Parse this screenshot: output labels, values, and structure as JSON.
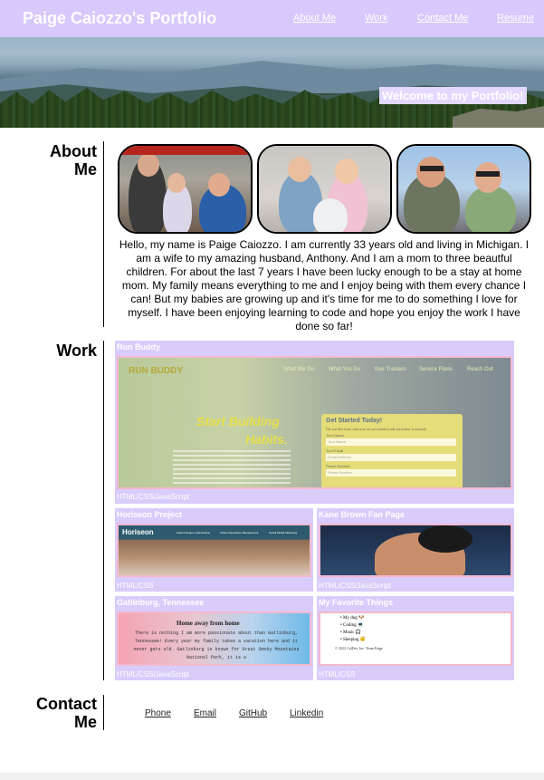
{
  "header": {
    "title": "Paige Caiozzo's Portfolio",
    "nav": [
      "About Me",
      "Work",
      "Contact Me",
      "Resume"
    ]
  },
  "hero": {
    "welcome": "Welcome to my Portfolio!"
  },
  "about": {
    "heading_line1": "About",
    "heading_line2": "Me",
    "text": "Hello, my name is Paige Caiozzo. I am currently 33 years old and living in Michigan. I am a wife to my amazing husband, Anthony. And I am a mom to three beautful children. For about the last 7 years I have been lucky enough to be a stay at home mom. My family means everything to me and I enjoy being with them every chance I can! But my babies are growing up and it's time for me to do something I love for myself. I have been enjoying learning to code and hope you enjoy the work I have done so far!"
  },
  "work": {
    "heading": "Work",
    "projects": [
      {
        "title": "Run Buddy",
        "tech": "HTML/CSS/JavaScript",
        "screenshot": {
          "logo": "RUN BUDDY",
          "nav": [
            "What We Do",
            "What You Do",
            "Your Trainers",
            "Service Plans",
            "Reach Out"
          ],
          "headline_1": "Start Building",
          "headline_2": "Habits.",
          "form_title": "Get Started Today!",
          "form_sub": "Fill out this form and one of our trainers will schedule a consult.",
          "field_1_label": "Your Name",
          "field_1_placeholder": "Your Name",
          "field_2_label": "Your Email",
          "field_2_placeholder": "Email Address",
          "field_3_label": "Phone Number",
          "field_3_placeholder": "Phone Number"
        }
      },
      {
        "title": "Horiseon Project",
        "tech": "HTML/CSS",
        "screenshot": {
          "logo": "Horiseon",
          "nav": [
            "Search Engine Optimization",
            "Online Reputation Management",
            "Social Media Marketing"
          ]
        }
      },
      {
        "title": "Kane Brown Fan Page",
        "tech": "HTML/CSS/JavaScript",
        "screenshot": {}
      },
      {
        "title": "Gatlinburg, Tennessee",
        "tech": "HTML/CSS/JavaScript",
        "screenshot": {
          "heading": "Home away from home",
          "body": "There is nothing I am more passionate about than Gatlinburg, Tennessee! Every year my family takes a vacation here and it never gets old. Gatlinburg is known for Great Smoky Mountains National Park, it is a"
        }
      },
      {
        "title": "My Favorite Things",
        "tech": "HTML/CSS",
        "screenshot": {
          "items": [
            "My dog 🐶",
            "Coding 💻",
            "Music 🎧",
            "Sleeping 😴"
          ],
          "footer": "© 2022 CalDev, Inc. Team Paige"
        }
      }
    ]
  },
  "contact": {
    "heading_line1": "Contact",
    "heading_line2": "Me",
    "links": [
      "Phone",
      "Email",
      "GitHub",
      "Linkedin"
    ]
  },
  "colors": {
    "header_bg": "#d7c9fb",
    "card_bg": "#d9ccfb",
    "card_border": "#f4b8cf",
    "text": "#000000",
    "white": "#ffffff"
  },
  "icons": []
}
